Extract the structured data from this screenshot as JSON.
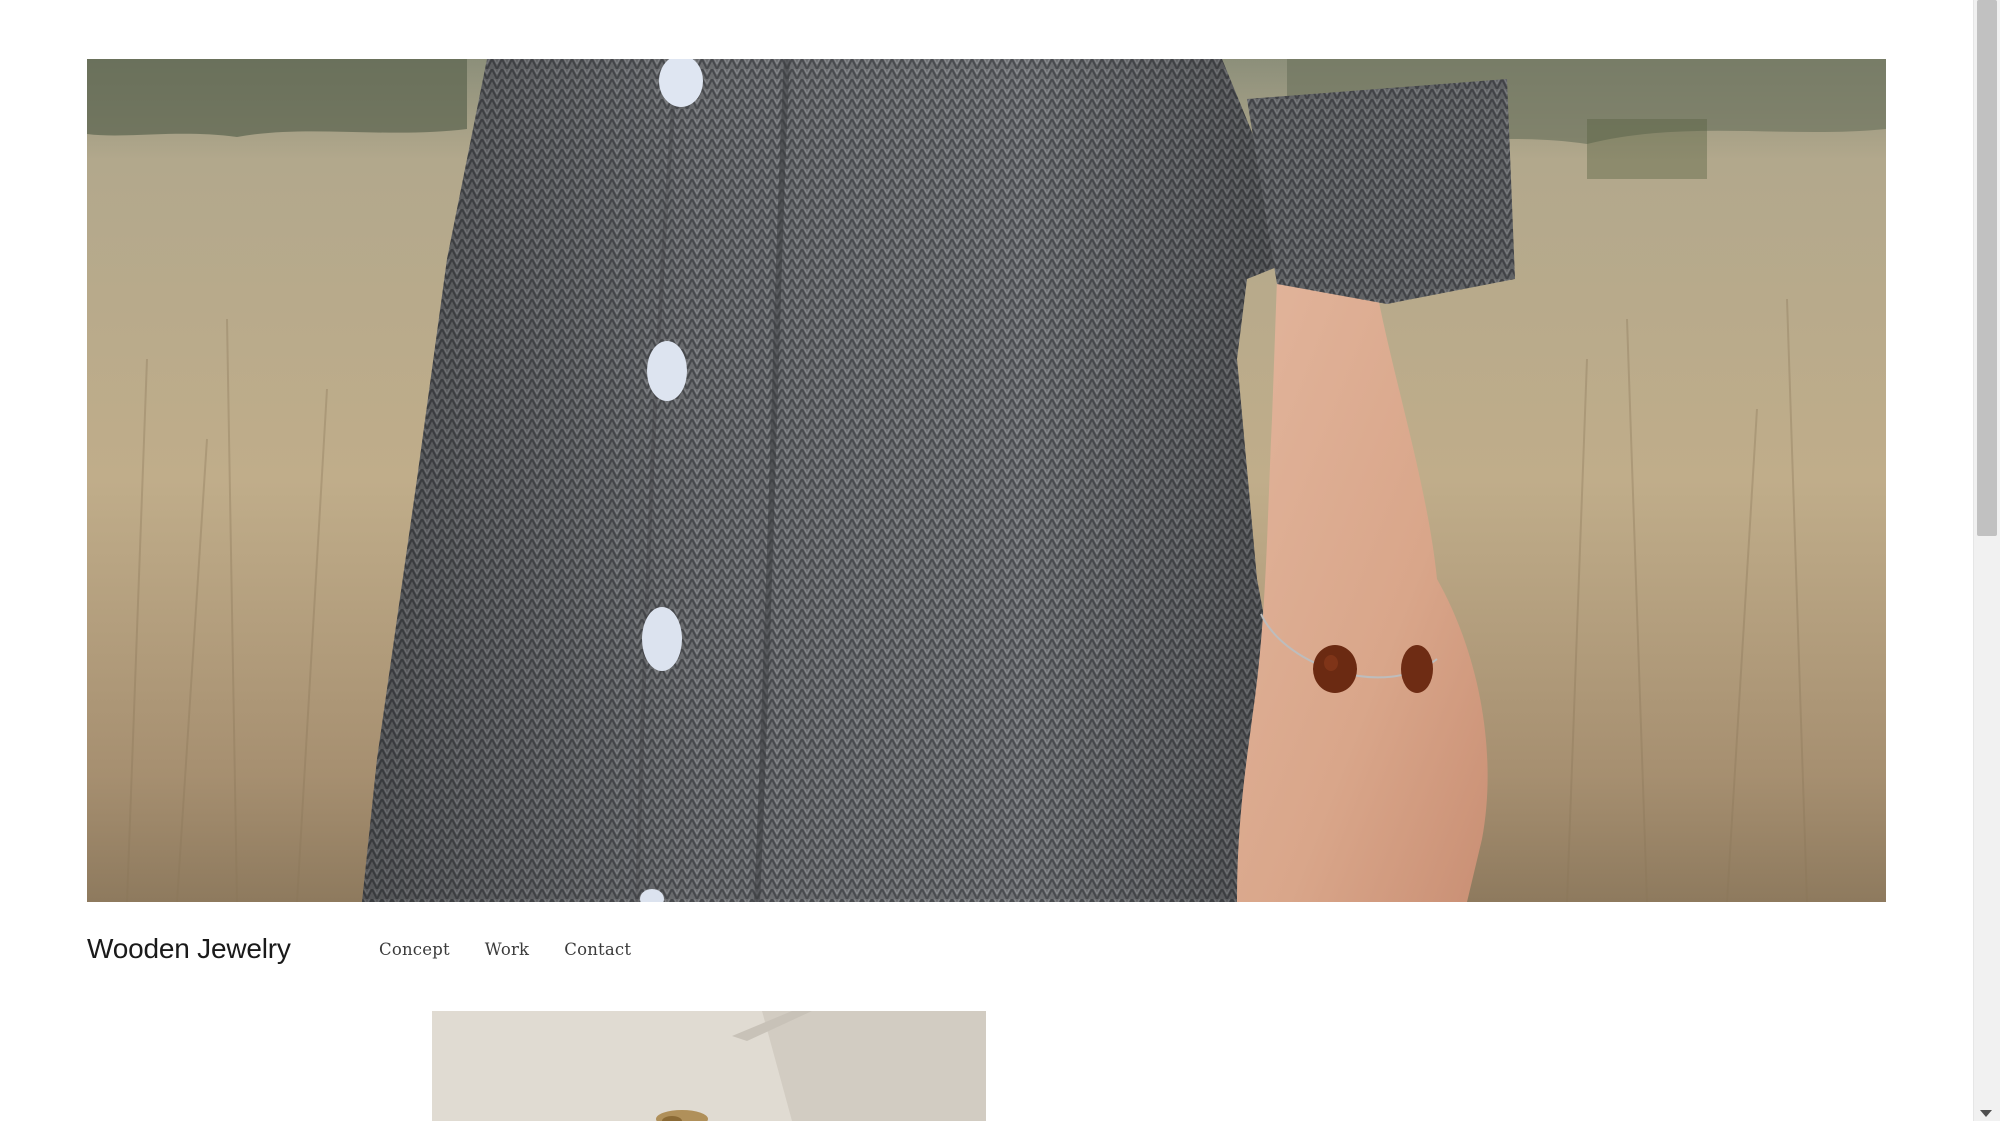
{
  "site": {
    "title": "Wooden Jewelry"
  },
  "nav": {
    "items": [
      {
        "label": "Concept"
      },
      {
        "label": "Work"
      },
      {
        "label": "Contact"
      }
    ]
  },
  "hero": {
    "icon": "hero-photo"
  },
  "gallery": {
    "icon": "gallery-photo"
  },
  "colors": {
    "text": "#1a1a1a",
    "nav_text": "#3b3b3b",
    "background": "#ffffff",
    "scrollbar_thumb": "#c1c1c1"
  }
}
